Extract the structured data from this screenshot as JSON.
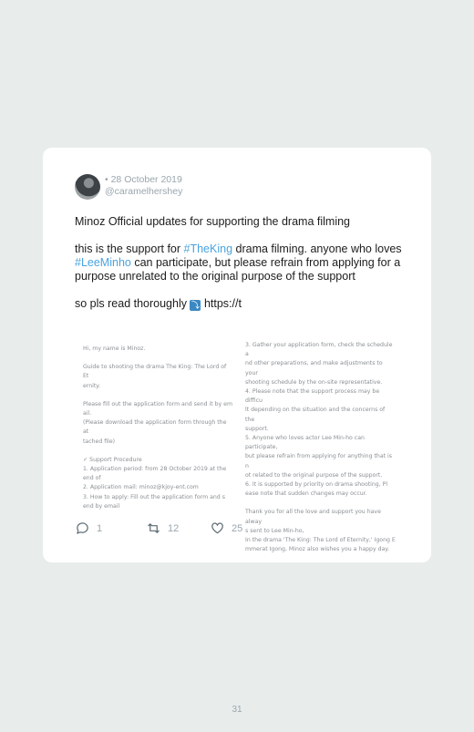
{
  "tweet": {
    "date": "• 28 October 2019",
    "handle": "@caramelhershey",
    "line1": "Minoz Official updates for supporting the drama filming",
    "p2_pre": "this is the support for ",
    "p2_tag1": "#TheKing",
    "p2_mid": " drama filming. anyone who loves ",
    "p2_tag2": "#LeeMinho",
    "p2_post": " can participate, but please refrain from applying for a purpose unrelated to the original purpose of the support",
    "p3_pre": "so pls read thoroughly ",
    "p3_emoji": "⤵",
    "p3_post": " https://t"
  },
  "doc": {
    "left": [
      "Hi, my name is Minoz.",
      "Guide to shooting the drama The King: The Lord of Et",
      "ernity.",
      "Please fill out the application form and send it by em",
      "ail.",
      "(Please download the application form through the at",
      "tached file)",
      "✓ Support Procedure",
      "1.    Application period: from 28 October 2019 at the",
      "end of",
      "2.    Application mail: minoz@kjoy-ent.com",
      "3.    How to apply: Fill out the application form and s",
      "end by email"
    ],
    "right": [
      "3. Gather your application form, check the schedule a",
      "nd other preparations, and make adjustments to your",
      "shooting schedule by the on-site representative.",
      "4. Please note that the support process may be difficu",
      "lt depending on the situation and the concerns of the",
      "support.",
      "5. Anyone who loves actor Lee Min-ho can participate,",
      "but please refrain from applying for anything that is n",
      "ot related to the original purpose of the support.",
      "6. It is supported by priority on drama shooting, Pl",
      "ease note that sudden changes may occur.",
      "Thank you for all the love and support you have alway",
      "s sent to Lee Min-ho,",
      "In the drama 'The King: The Lord of Eternity,' Igong E",
      "mmerat Igong, Minoz also wishes you a happy day."
    ]
  },
  "actions": {
    "replies": "1",
    "retweets": "12",
    "likes": "25"
  },
  "page": {
    "number": "31"
  }
}
